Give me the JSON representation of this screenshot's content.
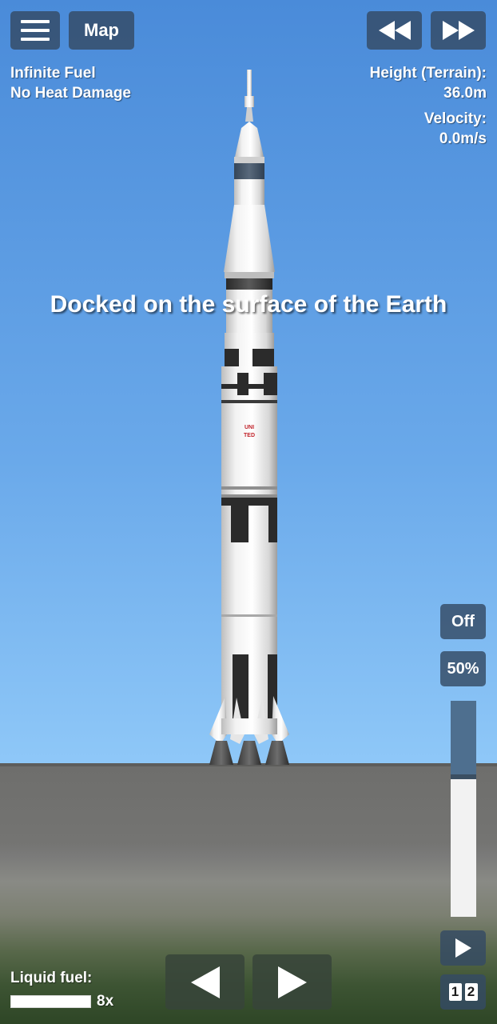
{
  "hud": {
    "menu_icon": "hamburger-menu-icon",
    "map_label": "Map",
    "rewind_icon": "rewind-icon",
    "fast_forward_icon": "fast-forward-icon",
    "cheats": [
      "Infinite Fuel",
      "No Heat Damage"
    ],
    "height_label": "Height (Terrain):",
    "height_value": "36.0m",
    "velocity_label": "Velocity:",
    "velocity_value": "0.0m/s"
  },
  "banner": "Docked on the surface of the Earth",
  "rocket": {
    "marking": "UNITED"
  },
  "controls": {
    "sas_label": "Off",
    "throttle_label": "50%",
    "throttle_level": 0.35,
    "play_icon": "play-icon",
    "rotate_left_icon": "rotate-left-icon",
    "rotate_right_icon": "rotate-right-icon",
    "stage_labels": [
      "1",
      "2"
    ]
  },
  "fuel": {
    "label": "Liquid fuel:",
    "multiplier": "8x",
    "level": 1.0
  },
  "colors": {
    "button_bg": "#344b64",
    "sky_top": "#4a8bd9",
    "sky_bottom": "#a2d6fb",
    "ground": "#747472",
    "throttle_fill": "#4e6f8f",
    "marking_red": "#c0232a"
  }
}
